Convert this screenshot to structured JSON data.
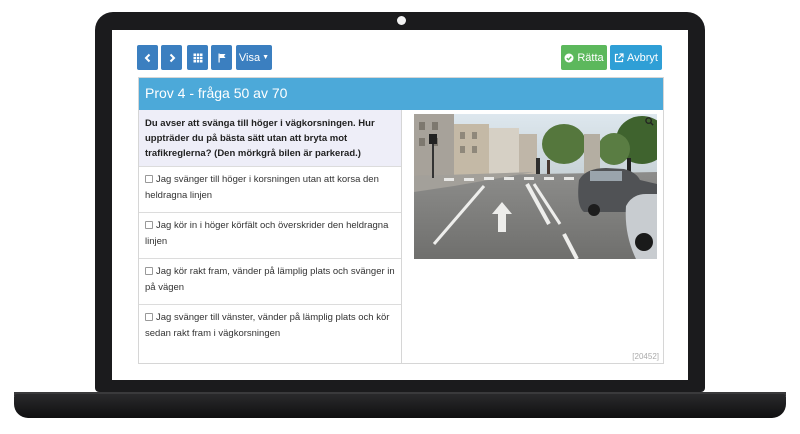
{
  "toolbar": {
    "prev_icon": "chevron-left-icon",
    "next_icon": "chevron-right-icon",
    "grid_icon": "grid-icon",
    "flag_icon": "flag-icon",
    "view_label": "Visa",
    "check_label": "Rätta",
    "check_icon": "check-circle-icon",
    "abort_label": "Avbryt",
    "abort_icon": "external-link-icon"
  },
  "panel": {
    "title": "Prov 4 - fråga 50 av 70"
  },
  "question": {
    "text": "Du avser att svänga till höger i vägkorsningen. Hur uppträder du på bästa sätt utan att bryta mot trafikreglerna? (Den mörkgrå bilen är parkerad.)",
    "image_label": "road-intersection-photo",
    "options": [
      "Jag svänger till höger i korsningen utan att korsa den heldragna linjen",
      "Jag kör in i höger körfält och överskrider den heldragna linjen",
      "Jag kör rakt fram, vänder på lämplig plats och svänger in på vägen",
      "Jag svänger till vänster, vänder på lämplig plats och kör sedan rakt fram i vägkorsningen"
    ],
    "id": "[20452]"
  },
  "colors": {
    "primary": "#3b7fc0",
    "success": "#5cb85c",
    "info": "#2f9fd6",
    "header": "#4ca9d9",
    "question_bg": "#eeeef8"
  }
}
